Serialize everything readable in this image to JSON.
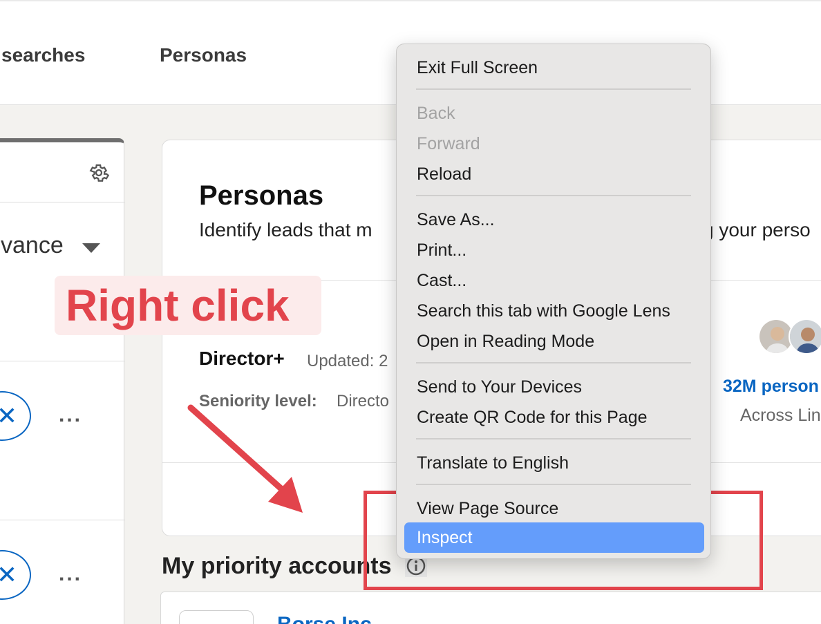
{
  "topnav": {
    "tabs": [
      {
        "label": "searches"
      },
      {
        "label": "Personas"
      }
    ]
  },
  "left_panel": {
    "sort_label": "vance",
    "settings_icon": "gear-icon",
    "rows": [
      {
        "dismiss_icon": "✕",
        "more_label": "..."
      },
      {
        "dismiss_icon": "✕",
        "more_label": "..."
      }
    ]
  },
  "personas_card": {
    "title": "Personas",
    "subtitle_left": "Identify leads that m",
    "subtitle_right": "g your perso",
    "persona": {
      "name": "Director+",
      "updated": "Updated: 2",
      "seniority_label": "Seniority level:",
      "seniority_value": "Directo",
      "persons_count": "32M person",
      "persons_scope": "Across Lin"
    }
  },
  "priority": {
    "title": "My priority accounts",
    "info_icon": "info-icon",
    "account_name": "Borse Inc"
  },
  "annotation": {
    "label": "Right click",
    "color": "#e2444c"
  },
  "context_menu": {
    "items": [
      {
        "label": "Exit Full Screen",
        "enabled": true
      },
      {
        "label": "Back",
        "enabled": false
      },
      {
        "label": "Forward",
        "enabled": false
      },
      {
        "label": "Reload",
        "enabled": true
      },
      {
        "label": "Save As...",
        "enabled": true
      },
      {
        "label": "Print...",
        "enabled": true
      },
      {
        "label": "Cast...",
        "enabled": true
      },
      {
        "label": "Search this tab with Google Lens",
        "enabled": true
      },
      {
        "label": "Open in Reading Mode",
        "enabled": true
      },
      {
        "label": "Send to Your Devices",
        "enabled": true
      },
      {
        "label": "Create QR Code for this Page",
        "enabled": true
      },
      {
        "label": "Translate to English",
        "enabled": true
      },
      {
        "label": "View Page Source",
        "enabled": true
      },
      {
        "label": "Inspect",
        "enabled": true,
        "highlighted": true
      }
    ],
    "highlight_color": "#649dfb"
  },
  "colors": {
    "brand_blue": "#0a66c2",
    "page_bg": "#f3f2ef"
  }
}
